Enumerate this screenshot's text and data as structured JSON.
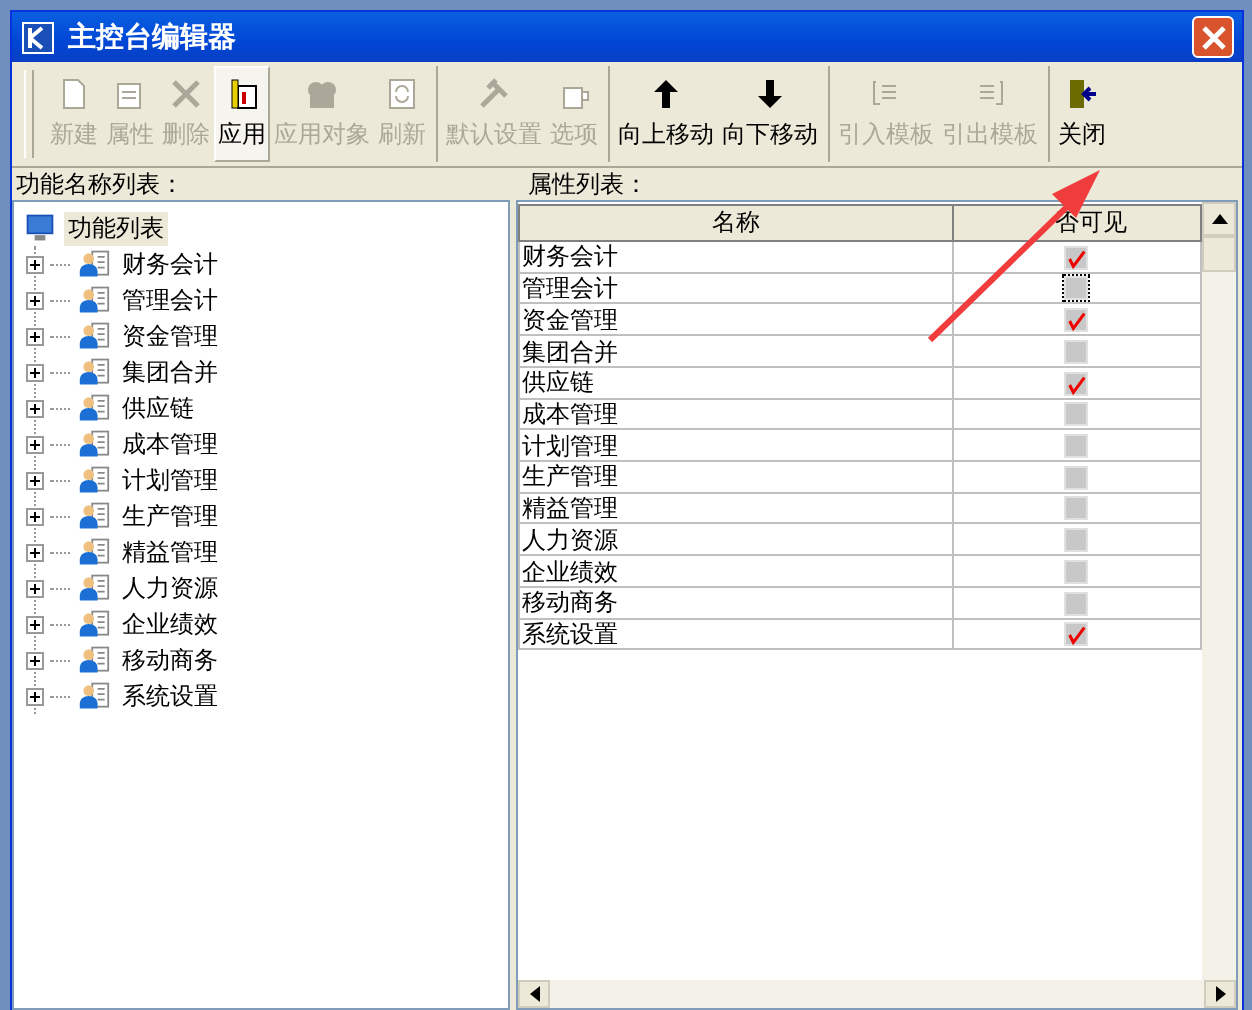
{
  "window": {
    "title": "主控台编辑器"
  },
  "toolbar": {
    "groups": [
      [
        {
          "label": "新建",
          "disabled": true,
          "pressed": false
        },
        {
          "label": "属性",
          "disabled": true,
          "pressed": false
        },
        {
          "label": "删除",
          "disabled": true,
          "pressed": false
        },
        {
          "label": "应用",
          "disabled": false,
          "pressed": true
        },
        {
          "label": "应用对象",
          "disabled": true,
          "pressed": false
        },
        {
          "label": "刷新",
          "disabled": true,
          "pressed": false
        }
      ],
      [
        {
          "label": "默认设置",
          "disabled": true,
          "pressed": false
        },
        {
          "label": "选项",
          "disabled": true,
          "pressed": false
        }
      ],
      [
        {
          "label": "向上移动",
          "disabled": false,
          "pressed": false
        },
        {
          "label": "向下移动",
          "disabled": false,
          "pressed": false
        }
      ],
      [
        {
          "label": "引入模板",
          "disabled": true,
          "pressed": false
        },
        {
          "label": "引出模板",
          "disabled": true,
          "pressed": false
        }
      ],
      [
        {
          "label": "关闭",
          "disabled": false,
          "pressed": false
        }
      ]
    ]
  },
  "left_panel": {
    "title": "功能名称列表：",
    "tree": [
      {
        "label": "功能列表",
        "selected": true,
        "children": [
          {
            "label": "财务会计",
            "selected": false,
            "expanded": false
          },
          {
            "label": "管理会计",
            "selected": false,
            "expanded": false
          },
          {
            "label": "资金管理",
            "selected": false,
            "expanded": false
          },
          {
            "label": "集团合并",
            "selected": false,
            "expanded": false
          },
          {
            "label": "供应链",
            "selected": false,
            "expanded": false
          },
          {
            "label": "成本管理",
            "selected": false,
            "expanded": false
          },
          {
            "label": "计划管理",
            "selected": false,
            "expanded": false
          },
          {
            "label": "生产管理",
            "selected": false,
            "expanded": false
          },
          {
            "label": "精益管理",
            "selected": false,
            "expanded": false
          },
          {
            "label": "人力资源",
            "selected": false,
            "expanded": false
          },
          {
            "label": "企业绩效",
            "selected": false,
            "expanded": false
          },
          {
            "label": "移动商务",
            "selected": false,
            "expanded": false
          },
          {
            "label": "系统设置",
            "selected": false,
            "expanded": false
          }
        ]
      }
    ]
  },
  "right_panel": {
    "title": "属性列表：",
    "table": {
      "columns": [
        "名称",
        "否可见"
      ],
      "rows": [
        {
          "name": "财务会计",
          "checked": true,
          "focused": false
        },
        {
          "name": "管理会计",
          "checked": false,
          "focused": true
        },
        {
          "name": "资金管理",
          "checked": true,
          "focused": false
        },
        {
          "name": "集团合并",
          "checked": false,
          "focused": false
        },
        {
          "name": "供应链",
          "checked": true,
          "focused": false
        },
        {
          "name": "成本管理",
          "checked": false,
          "focused": false
        },
        {
          "name": "计划管理",
          "checked": false,
          "focused": false
        },
        {
          "name": "生产管理",
          "checked": false,
          "focused": false
        },
        {
          "name": "精益管理",
          "checked": false,
          "focused": false
        },
        {
          "name": "人力资源",
          "checked": false,
          "focused": false
        },
        {
          "name": "企业绩效",
          "checked": false,
          "focused": false
        },
        {
          "name": "移动商务",
          "checked": false,
          "focused": false
        },
        {
          "name": "系统设置",
          "checked": true,
          "focused": false
        }
      ]
    }
  }
}
